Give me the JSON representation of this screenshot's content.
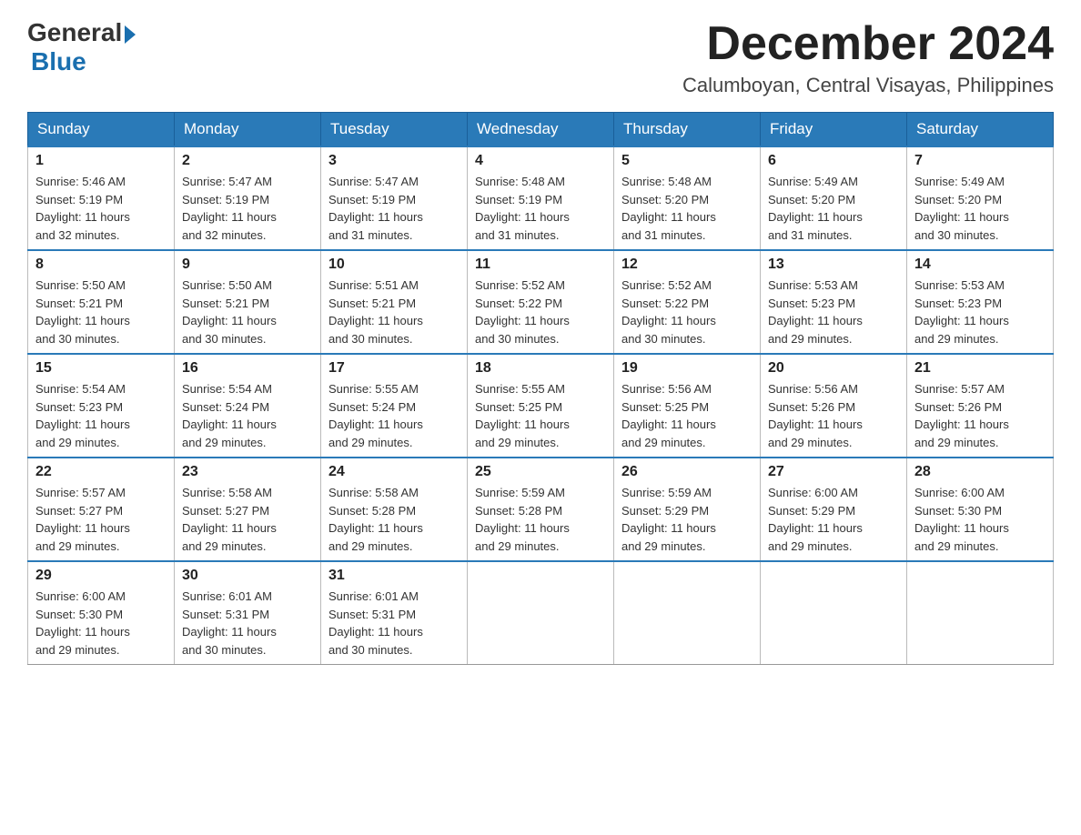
{
  "header": {
    "logo_general": "General",
    "logo_blue": "Blue",
    "month_title": "December 2024",
    "location": "Calumboyan, Central Visayas, Philippines"
  },
  "weekdays": [
    "Sunday",
    "Monday",
    "Tuesday",
    "Wednesday",
    "Thursday",
    "Friday",
    "Saturday"
  ],
  "weeks": [
    [
      {
        "day": "1",
        "sunrise": "5:46 AM",
        "sunset": "5:19 PM",
        "daylight": "11 hours and 32 minutes."
      },
      {
        "day": "2",
        "sunrise": "5:47 AM",
        "sunset": "5:19 PM",
        "daylight": "11 hours and 32 minutes."
      },
      {
        "day": "3",
        "sunrise": "5:47 AM",
        "sunset": "5:19 PM",
        "daylight": "11 hours and 31 minutes."
      },
      {
        "day": "4",
        "sunrise": "5:48 AM",
        "sunset": "5:19 PM",
        "daylight": "11 hours and 31 minutes."
      },
      {
        "day": "5",
        "sunrise": "5:48 AM",
        "sunset": "5:20 PM",
        "daylight": "11 hours and 31 minutes."
      },
      {
        "day": "6",
        "sunrise": "5:49 AM",
        "sunset": "5:20 PM",
        "daylight": "11 hours and 31 minutes."
      },
      {
        "day": "7",
        "sunrise": "5:49 AM",
        "sunset": "5:20 PM",
        "daylight": "11 hours and 30 minutes."
      }
    ],
    [
      {
        "day": "8",
        "sunrise": "5:50 AM",
        "sunset": "5:21 PM",
        "daylight": "11 hours and 30 minutes."
      },
      {
        "day": "9",
        "sunrise": "5:50 AM",
        "sunset": "5:21 PM",
        "daylight": "11 hours and 30 minutes."
      },
      {
        "day": "10",
        "sunrise": "5:51 AM",
        "sunset": "5:21 PM",
        "daylight": "11 hours and 30 minutes."
      },
      {
        "day": "11",
        "sunrise": "5:52 AM",
        "sunset": "5:22 PM",
        "daylight": "11 hours and 30 minutes."
      },
      {
        "day": "12",
        "sunrise": "5:52 AM",
        "sunset": "5:22 PM",
        "daylight": "11 hours and 30 minutes."
      },
      {
        "day": "13",
        "sunrise": "5:53 AM",
        "sunset": "5:23 PM",
        "daylight": "11 hours and 29 minutes."
      },
      {
        "day": "14",
        "sunrise": "5:53 AM",
        "sunset": "5:23 PM",
        "daylight": "11 hours and 29 minutes."
      }
    ],
    [
      {
        "day": "15",
        "sunrise": "5:54 AM",
        "sunset": "5:23 PM",
        "daylight": "11 hours and 29 minutes."
      },
      {
        "day": "16",
        "sunrise": "5:54 AM",
        "sunset": "5:24 PM",
        "daylight": "11 hours and 29 minutes."
      },
      {
        "day": "17",
        "sunrise": "5:55 AM",
        "sunset": "5:24 PM",
        "daylight": "11 hours and 29 minutes."
      },
      {
        "day": "18",
        "sunrise": "5:55 AM",
        "sunset": "5:25 PM",
        "daylight": "11 hours and 29 minutes."
      },
      {
        "day": "19",
        "sunrise": "5:56 AM",
        "sunset": "5:25 PM",
        "daylight": "11 hours and 29 minutes."
      },
      {
        "day": "20",
        "sunrise": "5:56 AM",
        "sunset": "5:26 PM",
        "daylight": "11 hours and 29 minutes."
      },
      {
        "day": "21",
        "sunrise": "5:57 AM",
        "sunset": "5:26 PM",
        "daylight": "11 hours and 29 minutes."
      }
    ],
    [
      {
        "day": "22",
        "sunrise": "5:57 AM",
        "sunset": "5:27 PM",
        "daylight": "11 hours and 29 minutes."
      },
      {
        "day": "23",
        "sunrise": "5:58 AM",
        "sunset": "5:27 PM",
        "daylight": "11 hours and 29 minutes."
      },
      {
        "day": "24",
        "sunrise": "5:58 AM",
        "sunset": "5:28 PM",
        "daylight": "11 hours and 29 minutes."
      },
      {
        "day": "25",
        "sunrise": "5:59 AM",
        "sunset": "5:28 PM",
        "daylight": "11 hours and 29 minutes."
      },
      {
        "day": "26",
        "sunrise": "5:59 AM",
        "sunset": "5:29 PM",
        "daylight": "11 hours and 29 minutes."
      },
      {
        "day": "27",
        "sunrise": "6:00 AM",
        "sunset": "5:29 PM",
        "daylight": "11 hours and 29 minutes."
      },
      {
        "day": "28",
        "sunrise": "6:00 AM",
        "sunset": "5:30 PM",
        "daylight": "11 hours and 29 minutes."
      }
    ],
    [
      {
        "day": "29",
        "sunrise": "6:00 AM",
        "sunset": "5:30 PM",
        "daylight": "11 hours and 29 minutes."
      },
      {
        "day": "30",
        "sunrise": "6:01 AM",
        "sunset": "5:31 PM",
        "daylight": "11 hours and 30 minutes."
      },
      {
        "day": "31",
        "sunrise": "6:01 AM",
        "sunset": "5:31 PM",
        "daylight": "11 hours and 30 minutes."
      },
      null,
      null,
      null,
      null
    ]
  ],
  "labels": {
    "sunrise": "Sunrise:",
    "sunset": "Sunset:",
    "daylight": "Daylight:"
  }
}
